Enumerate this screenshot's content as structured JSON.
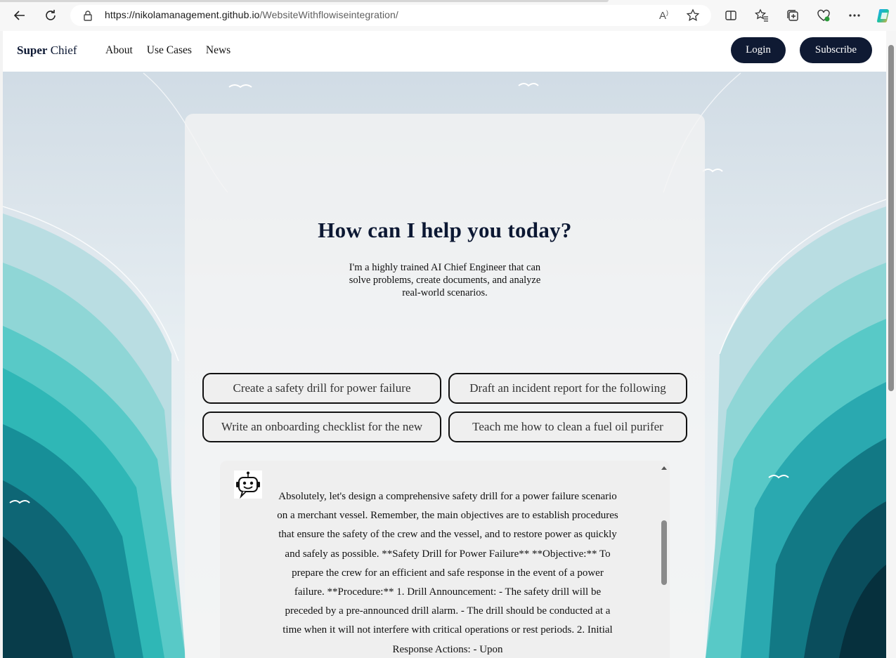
{
  "browser": {
    "url_host": "https://nikolamanagement.github.io",
    "url_path": "/WebsiteWithflowiseintegration/",
    "read_aloud_label": "A",
    "icons": [
      "back-arrow-icon",
      "refresh-icon",
      "lock-icon",
      "read-aloud-icon",
      "favorite-star-icon",
      "split-screen-icon",
      "favorites-icon",
      "collections-icon",
      "browser-essentials-icon",
      "more-icon",
      "copilot-icon"
    ]
  },
  "header": {
    "brand_bold": "Super",
    "brand_rest": "Chief",
    "nav": [
      "About",
      "Use Cases",
      "News"
    ],
    "login": "Login",
    "subscribe": "Subscribe"
  },
  "hero": {
    "title": "How can I help you today?",
    "subtitle": "I'm a highly trained AI Chief Engineer that can solve problems, create documents, and analyze real-world scenarios."
  },
  "suggestions": [
    "Create a safety drill for power failure",
    "Draft an incident report for the following",
    "Write an onboarding checklist for the new",
    "Teach me how to clean a fuel oil purifer"
  ],
  "chat": {
    "avatar_icon": "robot-icon",
    "message": "Absolutely, let's design a comprehensive safety drill for a power failure scenario on a merchant vessel. Remember, the main objectives are to establish procedures that ensure the safety of the crew and the vessel, and to restore power as quickly and safely as possible. **Safety Drill for Power Failure** **Objective:** To prepare the crew for an efficient and safe response in the event of a power failure. **Procedure:** 1. Drill Announcement: - The safety drill will be preceded by a pre-announced drill alarm. - The drill should be conducted at a time when it will not interfere with critical operations or rest periods. 2. Initial Response Actions: - Upon"
  },
  "colors": {
    "navy": "#0f1a33",
    "teal": "#2fc4c0",
    "deep_teal": "#0b4f5c"
  }
}
